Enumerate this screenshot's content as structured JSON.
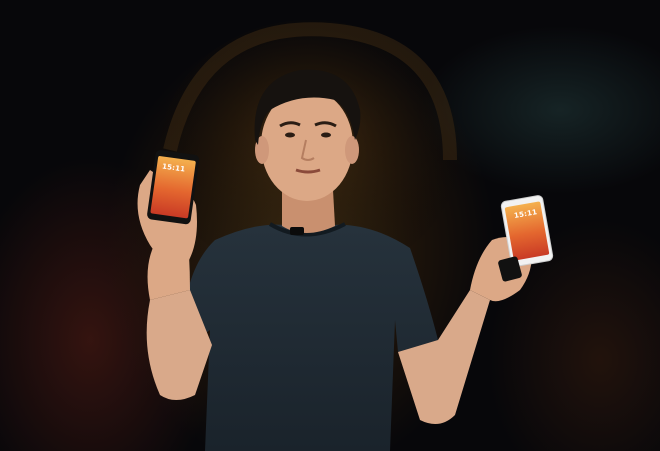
{
  "scene": {
    "description_label": "",
    "colors": {
      "background": "#07070a",
      "shirt": "#1f2a33",
      "skin": "#d9a98a",
      "hair": "#16120f",
      "phone_screen_gradient": [
        "#f0a24a",
        "#d8452c"
      ]
    }
  },
  "left_phone": {
    "clock": "15:11"
  },
  "right_phone": {
    "clock": "15:11"
  }
}
